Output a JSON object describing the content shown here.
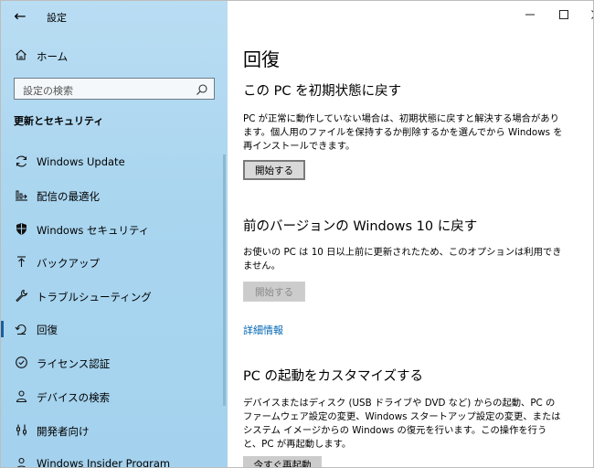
{
  "window": {
    "title": "設定"
  },
  "sidebar": {
    "home_label": "ホーム",
    "search_placeholder": "設定の検索",
    "section_title": "更新とセキュリティ",
    "items": [
      {
        "label": "Windows Update",
        "icon": "sync-icon"
      },
      {
        "label": "配信の最適化",
        "icon": "delivery-optimization-icon"
      },
      {
        "label": "Windows セキュリティ",
        "icon": "shield-icon"
      },
      {
        "label": "バックアップ",
        "icon": "upload-arrow-icon"
      },
      {
        "label": "トラブルシューティング",
        "icon": "wrench-icon"
      },
      {
        "label": "回復",
        "icon": "recovery-icon",
        "selected": true
      },
      {
        "label": "ライセンス認証",
        "icon": "check-circle-icon"
      },
      {
        "label": "デバイスの検索",
        "icon": "person-location-icon"
      },
      {
        "label": "開発者向け",
        "icon": "developer-icon"
      },
      {
        "label": "Windows Insider Program",
        "icon": "insider-icon"
      }
    ]
  },
  "main": {
    "title": "回復",
    "reset": {
      "heading": "この PC を初期状態に戻す",
      "description": "PC が正常に動作していない場合は、初期状態に戻すと解決する場合があります。個人用のファイルを保持するか削除するかを選んでから Windows を再インストールできます。",
      "button": "開始する"
    },
    "rollback": {
      "heading": "前のバージョンの Windows 10 に戻す",
      "description": "お使いの PC は 10 日以上前に更新されたため、このオプションは利用できません。",
      "button": "開始する",
      "link": "詳細情報"
    },
    "advanced": {
      "heading": "PC の起動をカスタマイズする",
      "description": "デバイスまたはディスク (USB ドライブや DVD など) からの起動、PC のファームウェア設定の変更、Windows スタートアップ設定の変更、またはシステム イメージからの Windows の復元を行います。この操作を行うと、PC が再起動します。",
      "button": "今すぐ再起動"
    }
  },
  "colors": {
    "sidebar_bg": "#a9d5ef",
    "link": "#0066b4",
    "selected_bar": "#1a5f9e"
  }
}
